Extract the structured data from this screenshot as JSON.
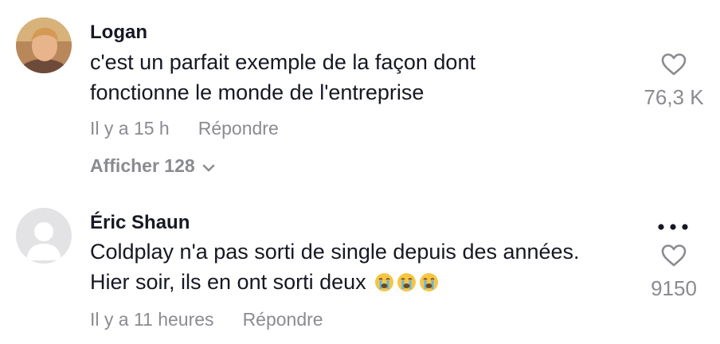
{
  "comments": [
    {
      "username": "Logan",
      "text_lines": [
        "c'est un parfait exemple de la façon dont",
        "fonctionne le monde de l'entreprise"
      ],
      "time": "Il y a 15 h",
      "reply": "Répondre",
      "likes": "76,3 K",
      "view_replies": "Afficher 128"
    },
    {
      "username": "Éric Shaun",
      "text_lines": [
        "Coldplay n'a pas sorti de single depuis des années.",
        "Hier soir, ils en ont sorti deux"
      ],
      "time": "Il y a 11 heures",
      "reply": "Répondre",
      "likes": "9150",
      "emojis": [
        "loudly-crying-face",
        "loudly-crying-face",
        "loudly-crying-face"
      ]
    }
  ],
  "colors": {
    "text": "#161823",
    "muted": "#8a8b91",
    "emoji": "#f7c544"
  }
}
